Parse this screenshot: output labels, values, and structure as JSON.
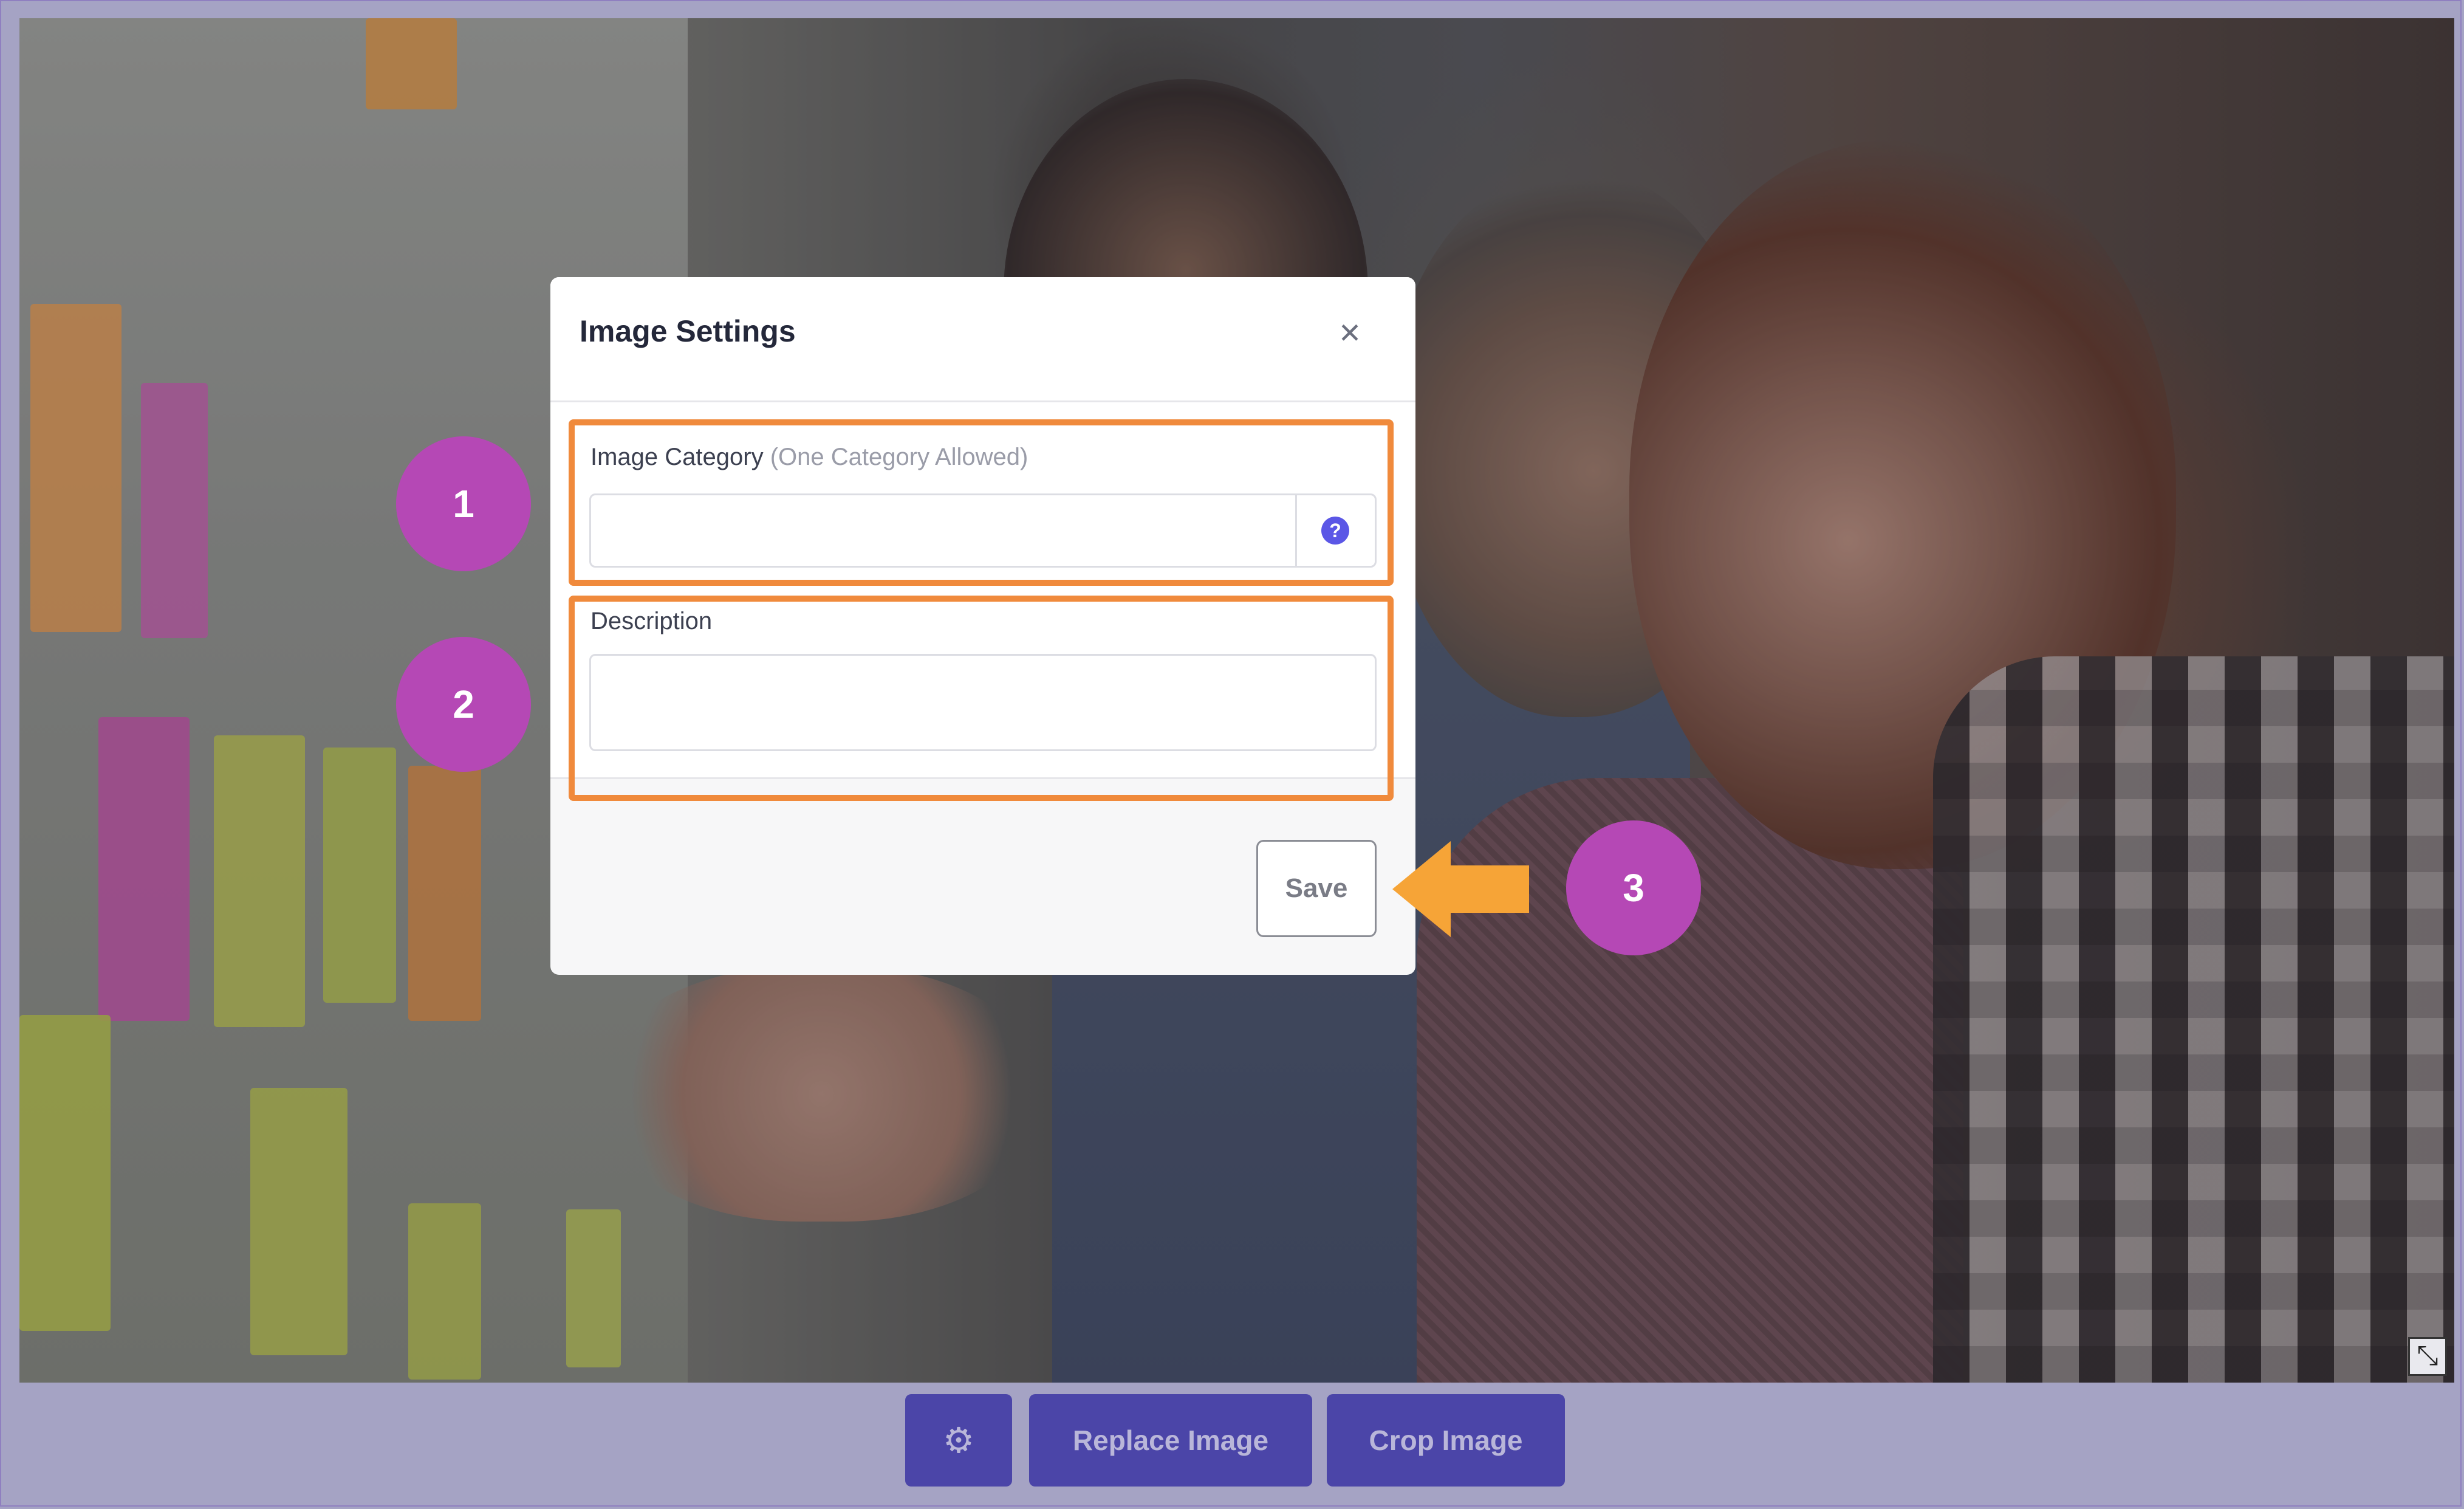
{
  "modal": {
    "title": "Image Settings",
    "close_symbol": "✕",
    "category_label": "Image Category",
    "category_hint": "(One Category Allowed)",
    "category_value": "",
    "help_symbol": "?",
    "description_label": "Description",
    "description_value": "",
    "save_label": "Save"
  },
  "toolbar": {
    "settings_icon": "gear-icon",
    "gear_symbol": "⚙",
    "replace_label": "Replace Image",
    "crop_label": "Crop Image"
  },
  "annotations": {
    "badge_1": "1",
    "badge_2": "2",
    "badge_3": "3",
    "highlight_color": "#f08a3c",
    "badge_color": "#b548b5",
    "arrow_color": "#f6a437"
  },
  "colors": {
    "toolbar_button": "#4b45a8",
    "help_icon": "#5b57e6"
  }
}
